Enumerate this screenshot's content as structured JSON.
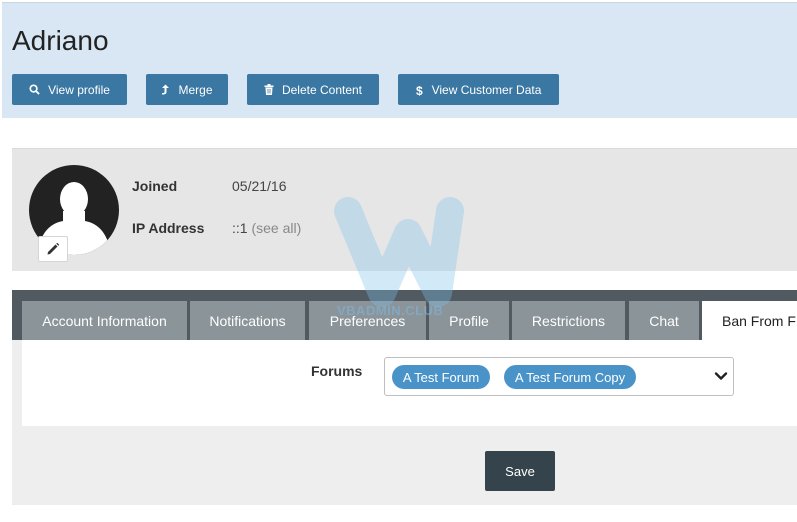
{
  "header": {
    "title": "Adriano",
    "buttons": {
      "view_profile": "View profile",
      "merge": "Merge",
      "delete_content": "Delete Content",
      "view_customer_data": "View Customer Data"
    }
  },
  "profile": {
    "joined_label": "Joined",
    "joined_value": "05/21/16",
    "ip_label": "IP Address",
    "ip_value": "::1",
    "ip_see_all": "(see all)"
  },
  "watermark": {
    "text": "VBADMIN.CLUB"
  },
  "tabs": [
    {
      "label": "Account Information"
    },
    {
      "label": "Notifications"
    },
    {
      "label": "Preferences"
    },
    {
      "label": "Profile"
    },
    {
      "label": "Restrictions"
    },
    {
      "label": "Chat"
    },
    {
      "label": "Ban From F"
    }
  ],
  "form": {
    "forums_label": "Forums",
    "selected_forums": [
      "A Test Forum",
      "A Test Forum Copy"
    ]
  },
  "footer": {
    "save_label": "Save"
  },
  "colors": {
    "header_bg": "#d8e7f3",
    "button_blue": "#3a77a2",
    "tabbar_bg": "#505a60",
    "tab_bg": "#8a9499",
    "chip_blue": "#4a93c9",
    "save_bg": "#34434c"
  },
  "icons": {
    "view_profile": "search-icon",
    "merge": "merge-arrow-icon",
    "delete_content": "trash-icon",
    "view_customer_data": "dollar-icon",
    "avatar_edit": "pencil-icon",
    "select": "chevron-down-icon"
  }
}
